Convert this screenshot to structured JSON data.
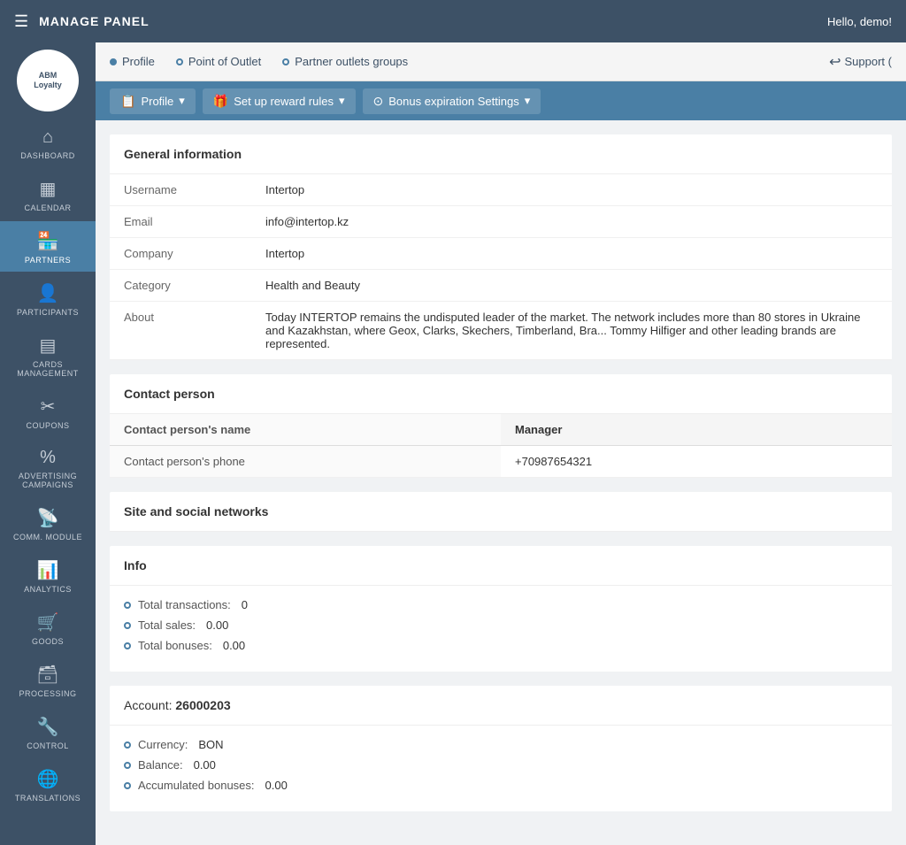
{
  "topbar": {
    "hamburger": "☰",
    "title": "MANAGE PANEL",
    "greeting": "Hello, demo!"
  },
  "logo": {
    "line1": "ABM",
    "line2": "Loyalty"
  },
  "sidebar": {
    "items": [
      {
        "id": "dashboard",
        "label": "DASHBOARD",
        "icon": "⌂"
      },
      {
        "id": "calendar",
        "label": "CALENDAR",
        "icon": "▦"
      },
      {
        "id": "partners",
        "label": "PARTNERS",
        "icon": "🏪",
        "active": true
      },
      {
        "id": "participants",
        "label": "PARTICIPANTS",
        "icon": "👤"
      },
      {
        "id": "cards",
        "label": "CARDS MANAGEMENT",
        "icon": "▤"
      },
      {
        "id": "coupons",
        "label": "COUPONS",
        "icon": "🏷"
      },
      {
        "id": "advertising",
        "label": "ADVERTISING CAMPAIGNS",
        "icon": "%"
      },
      {
        "id": "comm",
        "label": "COMM. MODULE",
        "icon": "📡"
      },
      {
        "id": "analytics",
        "label": "ANALYTICS",
        "icon": "📊"
      },
      {
        "id": "goods",
        "label": "GOODS",
        "icon": "🛒"
      },
      {
        "id": "processing",
        "label": "PROCESSING",
        "icon": "🗃"
      },
      {
        "id": "control",
        "label": "CONTROL",
        "icon": "🔧"
      },
      {
        "id": "translations",
        "label": "TRANSLATIONS",
        "icon": "🌐"
      }
    ]
  },
  "secondary_nav": {
    "items": [
      {
        "id": "profile",
        "label": "Profile",
        "active": true
      },
      {
        "id": "point_of_outlet",
        "label": "Point of Outlet",
        "active": false
      },
      {
        "id": "partner_outlets_groups",
        "label": "Partner outlets groups",
        "active": false
      }
    ],
    "support": "Support ("
  },
  "action_bar": {
    "profile_btn": "Profile",
    "setup_btn": "Set up reward rules",
    "bonus_btn": "Bonus expiration Settings"
  },
  "general_info": {
    "section_title": "General information",
    "rows": [
      {
        "label": "Username",
        "value": "Intertop"
      },
      {
        "label": "Email",
        "value": "info@intertop.kz"
      },
      {
        "label": "Company",
        "value": "Intertop"
      },
      {
        "label": "Category",
        "value": "Health and Beauty"
      },
      {
        "label": "About",
        "value": "Today INTERTOP remains the undisputed leader of the market. The network includes more than 80 stores in Ukraine and Kazakhstan, where Geox, Clarks, Skechers, Timberland, Bra... Tommy Hilfiger and other leading brands are represented."
      }
    ]
  },
  "contact_person": {
    "section_title": "Contact person",
    "headers": [
      "Contact person's name",
      "Manager"
    ],
    "rows": [
      {
        "label": "Contact person's phone",
        "value": "+70987654321"
      }
    ]
  },
  "site_social": {
    "section_title": "Site and social networks"
  },
  "info": {
    "section_title": "Info",
    "items": [
      {
        "label": "Total transactions:",
        "value": "0"
      },
      {
        "label": "Total sales:",
        "value": "0.00"
      },
      {
        "label": "Total bonuses:",
        "value": "0.00"
      }
    ]
  },
  "account": {
    "section_title": "Account:",
    "account_number": "26000203",
    "items": [
      {
        "label": "Currency:",
        "value": "BON"
      },
      {
        "label": "Balance:",
        "value": "0.00"
      },
      {
        "label": "Accumulated bonuses:",
        "value": "0.00"
      }
    ]
  }
}
